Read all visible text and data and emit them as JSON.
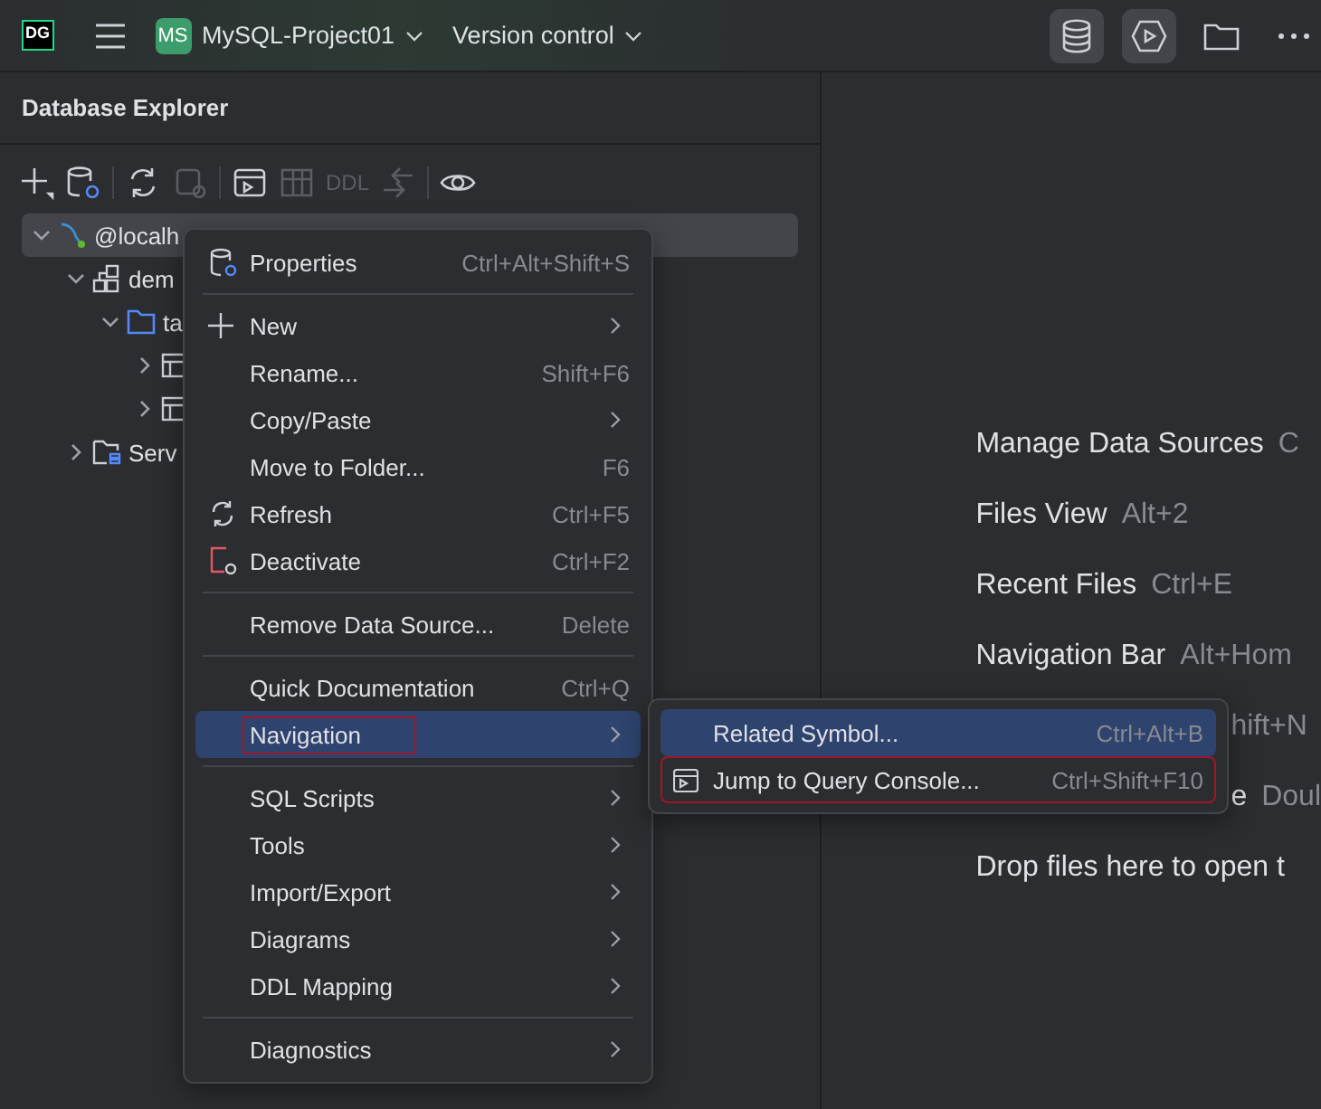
{
  "topbar": {
    "logo": "DG",
    "project_badge": "MS",
    "project": "MySQL-Project01",
    "vcs": "Version control",
    "tools": [
      {
        "selected": true
      },
      {
        "selected": true
      },
      {
        "selected": false
      },
      {
        "selected": false
      }
    ]
  },
  "explorer": {
    "title": "Database Explorer",
    "toolbar": [
      {
        "disabled": false
      },
      {
        "disabled": false
      },
      {
        "disabled": false
      },
      {
        "disabled": true
      },
      {
        "disabled": false
      },
      {
        "disabled": true
      },
      {
        "label": "DDL",
        "disabled": true
      },
      {
        "disabled": true
      },
      {
        "disabled": false
      }
    ],
    "tree": [
      {
        "kind": "datasource",
        "label": "@localh",
        "expanded": true,
        "selected": true,
        "children": [
          {
            "kind": "schema",
            "label": "dem",
            "expanded": true,
            "selected": false,
            "children": [
              {
                "kind": "folder",
                "label": "ta",
                "expanded": true,
                "selected": false,
                "children": [
                  {
                    "kind": "table",
                    "expanded": false,
                    "selected": false
                  },
                  {
                    "kind": "table",
                    "expanded": false,
                    "selected": false
                  }
                ]
              }
            ]
          },
          {
            "kind": "group",
            "label": "Serv",
            "expanded": false,
            "selected": false
          }
        ]
      }
    ]
  },
  "editor": {
    "hints": [
      {
        "label": "Manage Data Sources",
        "keys": "C"
      },
      {
        "label": "Files View",
        "keys": "Alt+2"
      },
      {
        "label": "Recent Files",
        "keys": "Ctrl+E"
      },
      {
        "label": "Navigation Bar",
        "keys": "Alt+Hom"
      },
      {
        "kind": "covered",
        "keys": "hift+N"
      },
      {
        "kind": "covered",
        "label": "e",
        "keys": "Doul"
      },
      {
        "label": "Drop files here to open t"
      }
    ]
  },
  "context_menu": {
    "groups": [
      [
        {
          "label": "Properties",
          "shortcut": "Ctrl+Alt+Shift+S",
          "submenu": false,
          "selected": false
        }
      ],
      [
        {
          "label": "New",
          "submenu": true,
          "selected": false
        },
        {
          "label": "Rename...",
          "shortcut": "Shift+F6",
          "submenu": false,
          "selected": false
        },
        {
          "label": "Copy/Paste",
          "submenu": true,
          "selected": false
        },
        {
          "label": "Move to Folder...",
          "shortcut": "F6",
          "submenu": false,
          "selected": false
        },
        {
          "label": "Refresh",
          "shortcut": "Ctrl+F5",
          "submenu": false,
          "selected": false
        },
        {
          "label": "Deactivate",
          "shortcut": "Ctrl+F2",
          "submenu": false,
          "selected": false
        }
      ],
      [
        {
          "label": "Remove Data Source...",
          "shortcut": "Delete",
          "submenu": false,
          "selected": false
        }
      ],
      [
        {
          "label": "Quick Documentation",
          "shortcut": "Ctrl+Q",
          "submenu": false,
          "selected": false
        },
        {
          "label": "Navigation",
          "submenu": true,
          "selected": true,
          "highlighted": true
        }
      ],
      [
        {
          "label": "SQL Scripts",
          "submenu": true,
          "selected": false
        },
        {
          "label": "Tools",
          "submenu": true,
          "selected": false
        },
        {
          "label": "Import/Export",
          "submenu": true,
          "selected": false
        },
        {
          "label": "Diagrams",
          "submenu": true,
          "selected": false
        },
        {
          "label": "DDL Mapping",
          "submenu": true,
          "selected": false
        }
      ],
      [
        {
          "label": "Diagnostics",
          "submenu": true,
          "selected": false
        }
      ]
    ]
  },
  "submenu": {
    "items": [
      {
        "label": "Related Symbol...",
        "shortcut": "Ctrl+Alt+B",
        "selected": true,
        "highlighted": false
      },
      {
        "label": "Jump to Query Console...",
        "shortcut": "Ctrl+Shift+F10",
        "selected": false,
        "highlighted": true
      }
    ]
  }
}
